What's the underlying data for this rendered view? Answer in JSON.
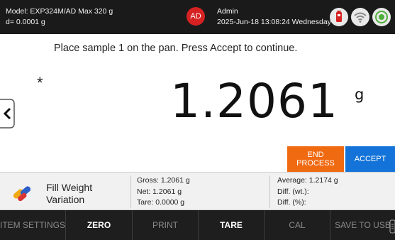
{
  "header": {
    "model_line": "Model: EXP324M/AD   Max 320 g",
    "d_line": "d= 0.0001 g",
    "avatar_initials": "AD",
    "user_name": "Admin",
    "datetime": "2025-Jun-18 13:08:24 Wednesday"
  },
  "main": {
    "prompt": "Place sample 1 on the pan. Press Accept to continue.",
    "stability_marker": "*",
    "reading": "1.2061",
    "unit": "g"
  },
  "actions": {
    "end_process": "END PROCESS",
    "accept": "ACCEPT"
  },
  "info": {
    "app_name": "Fill Weight Variation",
    "gross": "Gross: 1.2061 g",
    "net": "Net: 1.2061 g",
    "tare": "Tare: 0.0000 g",
    "average": "Average: 1.2174 g",
    "diff_wt": "Diff. (wt.):",
    "diff_pct": "Diff. (%):"
  },
  "bottom_bar": {
    "item_settings": "ITEM SETTINGS",
    "zero": "ZERO",
    "print": "PRINT",
    "tare": "TARE",
    "cal": "CAL",
    "save_to_usb": "SAVE TO USB"
  },
  "colors": {
    "header_bg": "#1a1a1a",
    "avatar": "#d62222",
    "end_process": "#f06a12",
    "accept": "#1373d8",
    "bottom_bar_bg": "#1e1e1e"
  },
  "icons": [
    "usb-icon",
    "wifi-icon",
    "target-icon",
    "chevron-left-icon",
    "fill-weight-icon"
  ]
}
